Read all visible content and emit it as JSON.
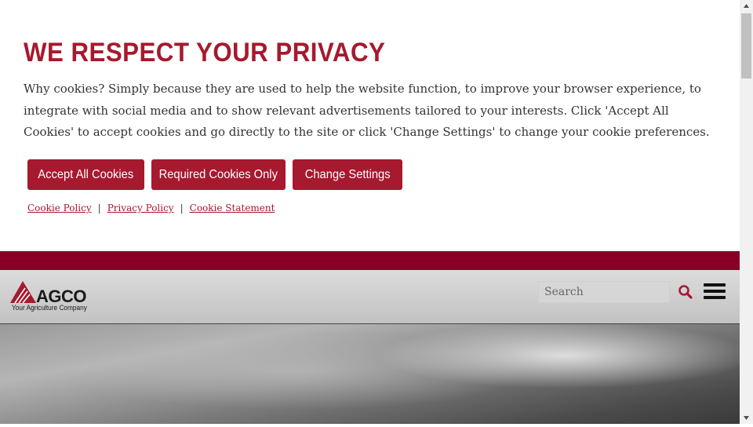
{
  "cookie_banner": {
    "title": "WE RESPECT YOUR PRIVACY",
    "body": "Why cookies? Simply because they are used to help the website function, to improve your browser experience, to integrate with social media and to show relevant advertisements tailored to your interests. Click 'Accept All Cookies' to accept cookies and go directly to the site or click 'Change Settings' to change your cookie preferences.",
    "buttons": {
      "accept_all": "Accept All Cookies",
      "required_only": "Required Cookies Only",
      "change_settings": "Change Settings"
    },
    "links": {
      "cookie_policy": "Cookie Policy",
      "privacy_policy": "Privacy Policy",
      "cookie_statement": "Cookie Statement",
      "separator": "|"
    }
  },
  "header": {
    "logo_text": "AGCO",
    "logo_tagline": "Your Agriculture Company",
    "search_placeholder": "Search"
  },
  "icons": {
    "search": "search-icon",
    "menu": "hamburger-menu-icon",
    "scroll_up": "scroll-up-arrow-icon",
    "scroll_down": "scroll-down-arrow-icon"
  },
  "colors": {
    "brand_red": "#a6192e",
    "band_red": "#8a0024"
  }
}
